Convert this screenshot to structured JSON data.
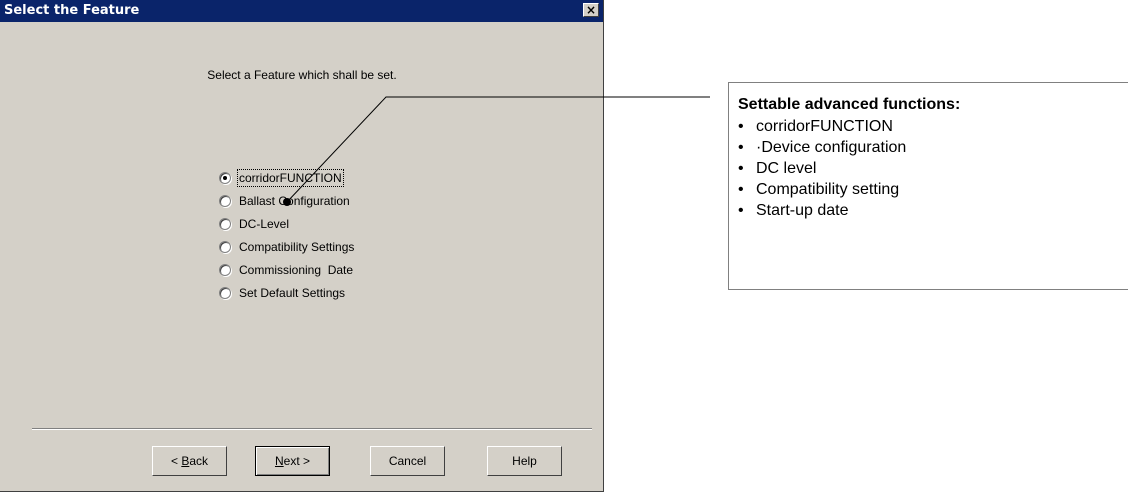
{
  "dialog": {
    "title": "Select the Feature",
    "close_label": "×",
    "prompt": "Select a Feature which shall be set.",
    "options": [
      {
        "label": "corridorFUNCTION",
        "checked": true
      },
      {
        "label": "Ballast Configuration",
        "checked": false
      },
      {
        "label": "DC-Level",
        "checked": false
      },
      {
        "label": "Compatibility Settings",
        "checked": false
      },
      {
        "label": "Commissioning  Date",
        "checked": false
      },
      {
        "label": "Set Default Settings",
        "checked": false
      }
    ],
    "buttons": {
      "back_accel": "B",
      "back_rest": "ack",
      "next_accel": "N",
      "next_rest": "ext >",
      "cancel": "Cancel",
      "help": "Help"
    }
  },
  "annotation": {
    "title": "Settable advanced functions:",
    "items": [
      "corridorFUNCTION",
      "·Device configuration",
      "DC level",
      "Compatibility setting",
      "Start-up date"
    ]
  },
  "colors": {
    "dialog_bg": "#d4d0c8",
    "titlebar_bg": "#0a246a",
    "titlebar_text": "#ffffff"
  }
}
